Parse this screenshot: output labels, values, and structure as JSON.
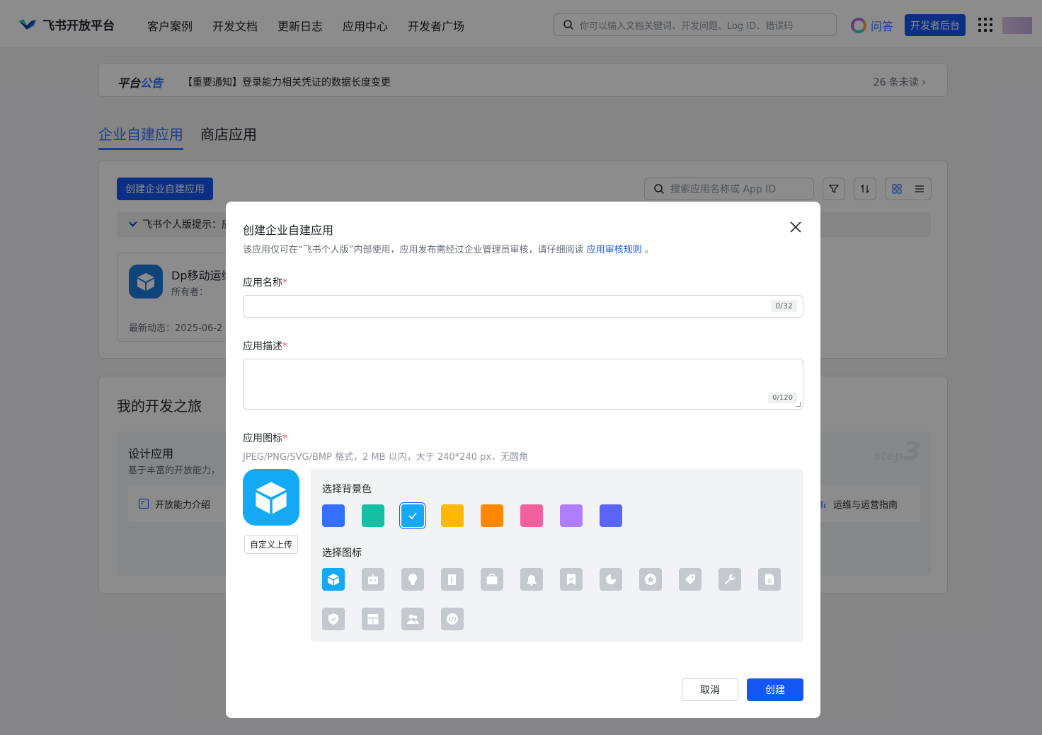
{
  "topnav": {
    "logo_text": "飞书开放平台",
    "items": [
      "客户案例",
      "开发文档",
      "更新日志",
      "应用中心",
      "开发者广场"
    ],
    "search_placeholder": "你可以输入文档关键词、开发问题、Log ID、错误码",
    "qa_label": "问答",
    "dev_console_label": "开发者后台"
  },
  "notice": {
    "title_a": "平台",
    "title_b": "公告",
    "text": "【重要通知】登录能力相关凭证的数据长度变更",
    "unread": "26 条未读 ›"
  },
  "tabs": [
    "企业自建应用",
    "商店应用"
  ],
  "apps_panel": {
    "create_button": "创建企业自建应用",
    "search_placeholder": "搜索应用名称或 App ID",
    "hint": "飞书个人版提示：应",
    "card": {
      "name": "Dp移动运维",
      "owner": "所有者：",
      "latest": "最新动态：2025-06-2"
    }
  },
  "journey": {
    "title": "我的开发之旅",
    "step_name": "设计应用",
    "step_desc": "基于丰富的开放能力，",
    "link1": "开放能力介绍",
    "link2": "运维与运营指南",
    "step_label": "step",
    "step_number": "3"
  },
  "modal": {
    "title": "创建企业自建应用",
    "subtitle_pre": "该应用仅可在“飞书个人版”内部使用，应用发布需经过企业管理员审核，请仔细阅读",
    "subtitle_link": "应用审核规则",
    "subtitle_post": "。",
    "name_label": "应用名称",
    "name_counter": "0/32",
    "desc_label": "应用描述",
    "desc_counter": "0/120",
    "icon_label": "应用图标",
    "required_mark": "*",
    "icon_desc": "JPEG/PNG/SVG/BMP 格式，2 MB 以内，大于 240*240 px，无圆角",
    "upload_label": "自定义上传",
    "bg_label": "选择背景色",
    "glyph_label": "选择图标",
    "cancel": "取消",
    "create": "创建",
    "bg_colors": [
      "#3370ff",
      "#14c0a1",
      "#14a9f5",
      "#ffb800",
      "#ff8800",
      "#f0609e",
      "#b17dff",
      "#5b65f5"
    ],
    "selected_bg_index": 2,
    "glyphs": [
      "cube-icon",
      "robot-icon",
      "bulb-icon",
      "book-icon",
      "briefcase-icon",
      "bell-icon",
      "bookmark-icon",
      "pie-icon",
      "star-icon",
      "tag-icon",
      "wrench-icon",
      "document-icon",
      "shield-icon",
      "layout-icon",
      "people-icon",
      "code-icon"
    ],
    "selected_glyph_index": 0
  }
}
